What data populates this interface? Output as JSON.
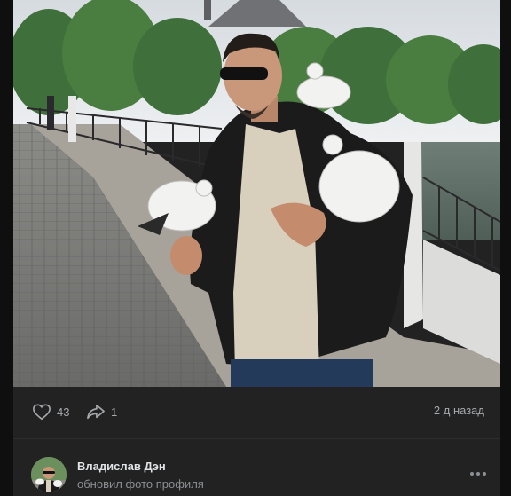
{
  "post": {
    "likes": "43",
    "shares": "1",
    "time": "2 д назад",
    "author": {
      "name": "Владислав Дэн",
      "action": "обновил фото профиля"
    }
  },
  "icons": {
    "like": "heart-icon",
    "share": "share-arrow-icon",
    "more": "more-dots-icon"
  },
  "colors": {
    "background": "#0f0f10",
    "card": "#222222",
    "text_primary": "#e1e3e6",
    "text_secondary": "#a6a9ad"
  }
}
